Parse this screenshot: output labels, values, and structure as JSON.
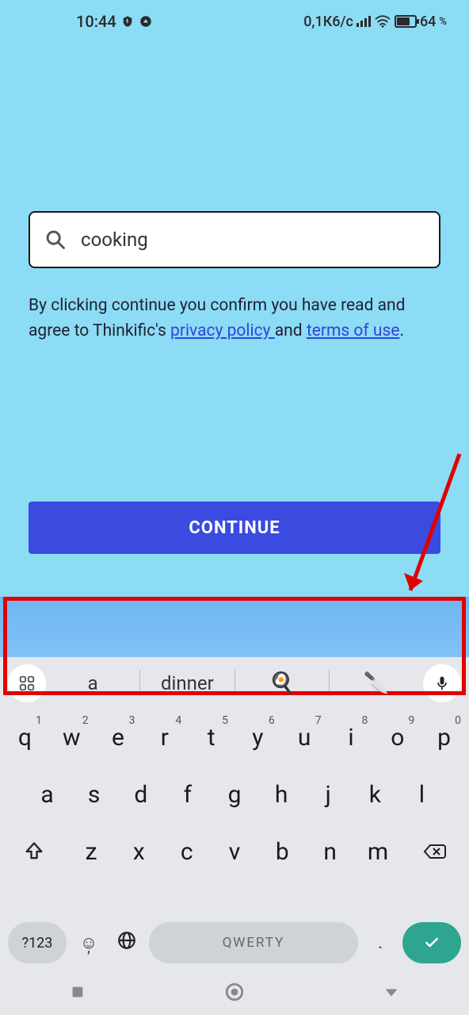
{
  "status": {
    "time": "10:44",
    "data_rate": "0,1К6/с",
    "battery_pct": "64",
    "battery_suffix": "%"
  },
  "search": {
    "value": "cooking",
    "placeholder": ""
  },
  "disclaimer": {
    "prefix": "By clicking continue you confirm you have read and agree to Thinkific's ",
    "link1": "privacy policy ",
    "mid": "and ",
    "link2": "terms of use",
    "suffix": "."
  },
  "continue_label": "CONTINUE",
  "keyboard": {
    "suggestions": {
      "s1": "a",
      "s2": "dinner"
    },
    "row1": [
      {
        "k": "q",
        "n": "1"
      },
      {
        "k": "w",
        "n": "2"
      },
      {
        "k": "e",
        "n": "3"
      },
      {
        "k": "r",
        "n": "4"
      },
      {
        "k": "t",
        "n": "5"
      },
      {
        "k": "y",
        "n": "6"
      },
      {
        "k": "u",
        "n": "7"
      },
      {
        "k": "i",
        "n": "8"
      },
      {
        "k": "o",
        "n": "9"
      },
      {
        "k": "p",
        "n": "0"
      }
    ],
    "row2": [
      "a",
      "s",
      "d",
      "f",
      "g",
      "h",
      "j",
      "k",
      "l"
    ],
    "row3": [
      "z",
      "x",
      "c",
      "v",
      "b",
      "n",
      "m"
    ],
    "sym_label": "?123",
    "space_label": "QWERTY",
    "dot": "."
  }
}
